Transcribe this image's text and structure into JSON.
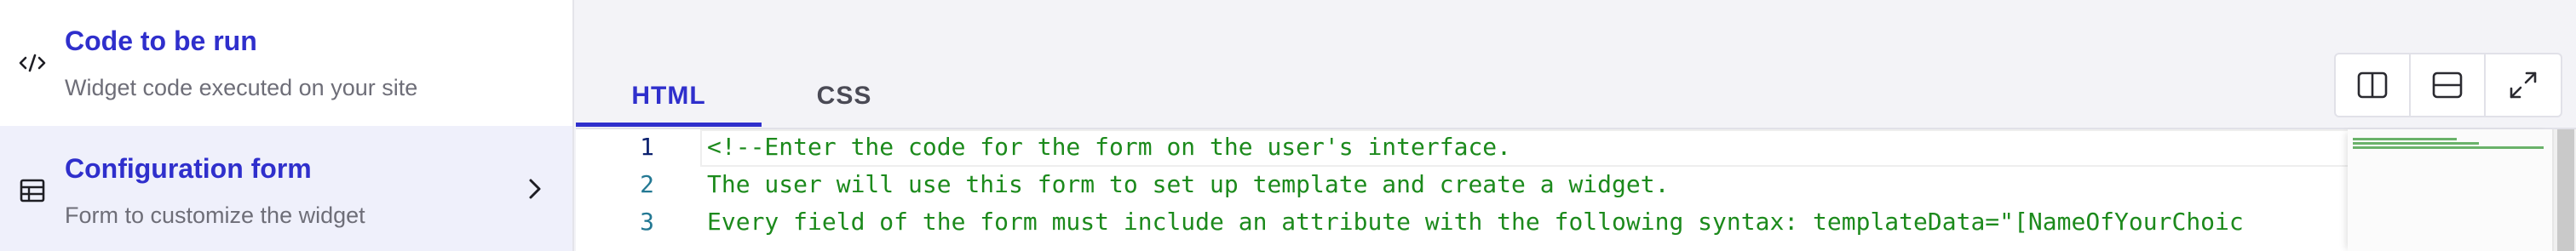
{
  "sidebar": {
    "items": [
      {
        "title": "Code to be run",
        "subtitle": "Widget code executed on your site",
        "icon": "code-icon"
      },
      {
        "title": "Configuration form",
        "subtitle": "Form to customize the widget",
        "icon": "table-icon",
        "chevron": "chevron-right-icon"
      }
    ]
  },
  "tabs": [
    {
      "label": "HTML",
      "active": true
    },
    {
      "label": "CSS",
      "active": false
    }
  ],
  "toolbar": {
    "buttons": [
      "split-vertical-icon",
      "split-horizontal-icon",
      "expand-icon"
    ]
  },
  "editor": {
    "lines": [
      {
        "number": "1",
        "text": "<!--Enter the code for the form on the user's interface."
      },
      {
        "number": "2",
        "text": "The user will use this form to set up template and create a widget."
      },
      {
        "number": "3",
        "text": "Every field of the form must include an attribute with the following syntax: templateData=\"[NameOfYourChoic"
      }
    ]
  },
  "colors": {
    "accent": "#2f2fcc",
    "comment": "#1c8a1c",
    "line_number": "#237893",
    "sidebar_active_bg": "#eff0fb"
  }
}
